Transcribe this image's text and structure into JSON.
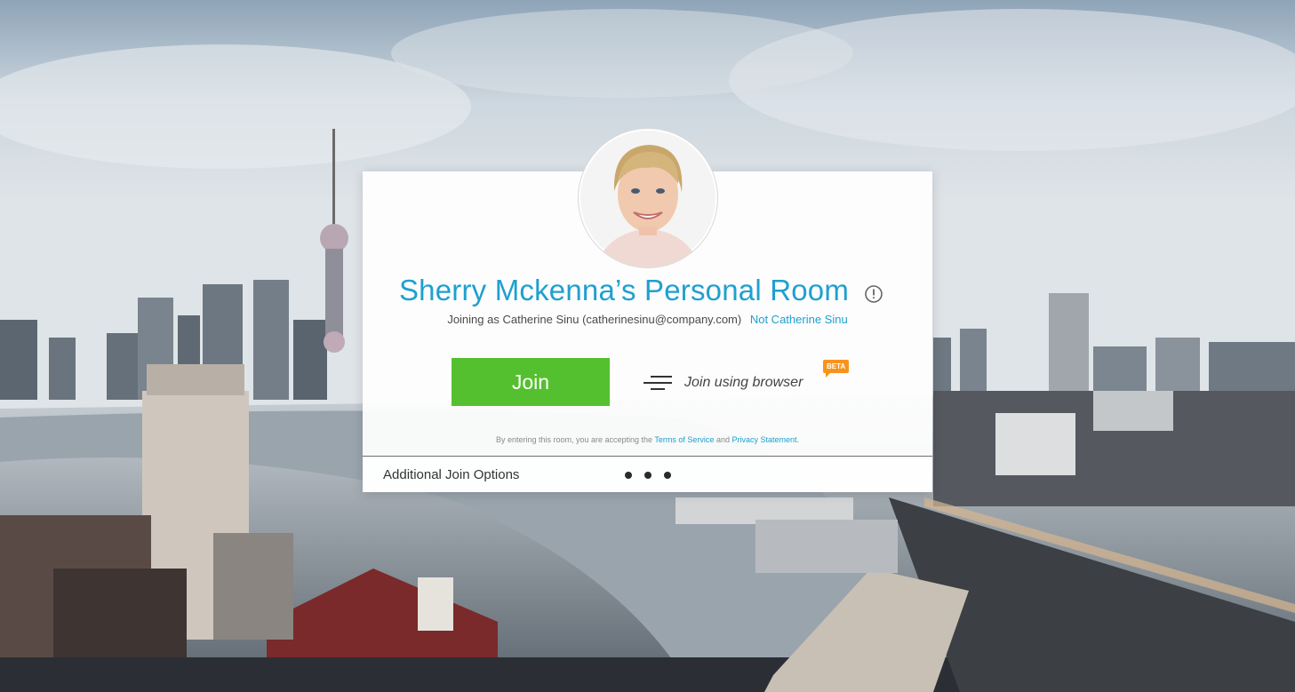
{
  "meeting": {
    "host_name": "Sherry Mckenna",
    "room_title": "Sherry Mckenna’s Personal Room",
    "joining_text": "Joining as Catherine Sinu (catherinesinu@company.com)",
    "not_user_link": "Not Catherine Sinu"
  },
  "actions": {
    "join_label": "Join",
    "browser_join_label": "Join using browser",
    "beta_badge": "BETA",
    "additional_options_label": "Additional Join Options"
  },
  "legal": {
    "prefix": "By entering this room, you are accepting the",
    "terms_link": "Terms of Service",
    "conjunction": "and",
    "privacy_link": "Privacy Statement",
    "suffix": "."
  },
  "icons": {
    "info": "info-icon",
    "browser": "browser-lines-icon",
    "more": "more-dots-icon"
  },
  "colors": {
    "accent_blue": "#1fa0cf",
    "join_green": "#55c02f",
    "beta_orange": "#f7941d"
  }
}
